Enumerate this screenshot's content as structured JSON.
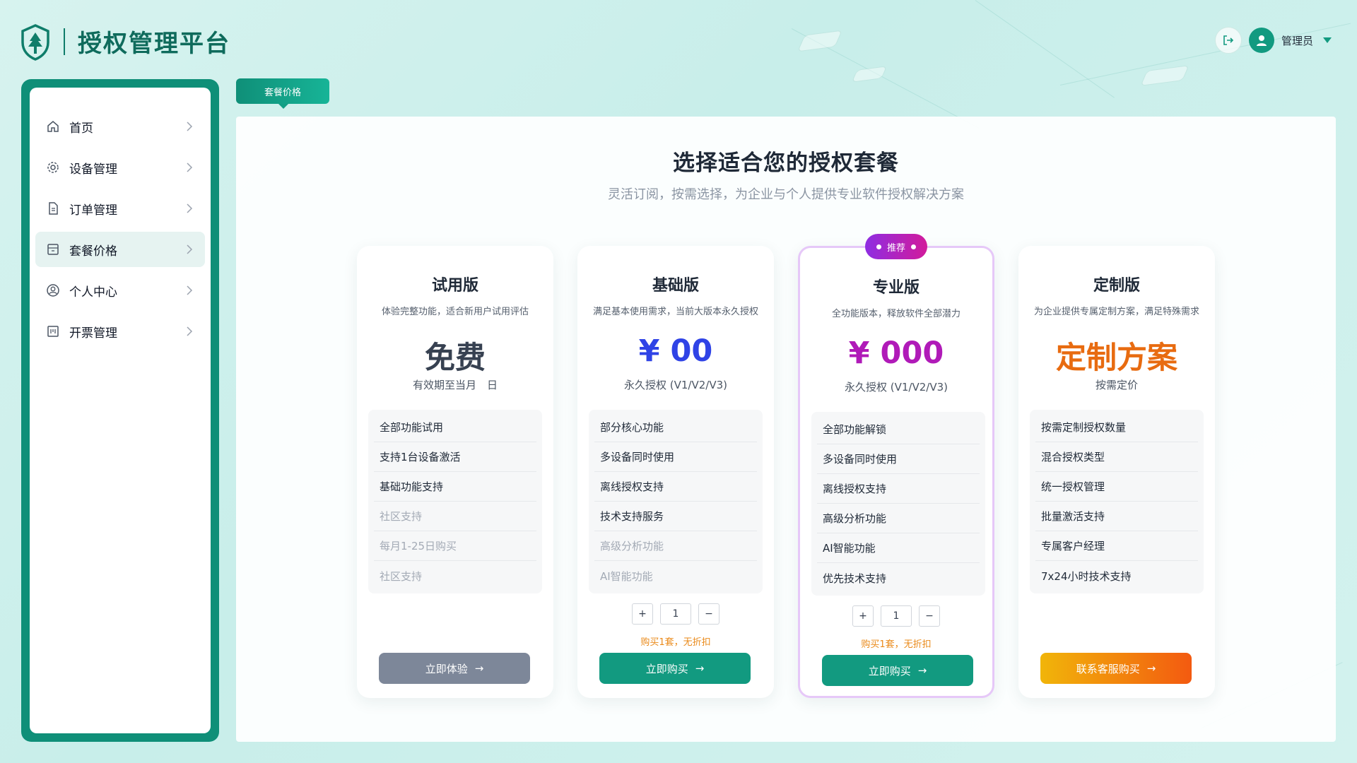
{
  "app": {
    "title": "授权管理平台"
  },
  "user": {
    "name": "管理员"
  },
  "sidebar": {
    "items": [
      {
        "label": "首页",
        "icon": "home-icon"
      },
      {
        "label": "设备管理",
        "icon": "gear-icon"
      },
      {
        "label": "订单管理",
        "icon": "document-icon"
      },
      {
        "label": "套餐价格",
        "icon": "package-icon",
        "active": true
      },
      {
        "label": "个人中心",
        "icon": "user-circle-icon"
      },
      {
        "label": "开票管理",
        "icon": "invoice-icon"
      }
    ]
  },
  "tab": {
    "label": "套餐价格"
  },
  "main": {
    "title": "选择适合您的授权套餐",
    "subtitle": "灵活订阅，按需选择，为企业与个人提供专业软件授权解决方案"
  },
  "plans": [
    {
      "name": "试用版",
      "desc": "体验完整功能，适合新用户试用评估",
      "price": "免费",
      "note": "有效期至当月　日",
      "features": [
        "全部功能试用",
        "支持1台设备激活",
        "基础功能支持",
        "社区支持",
        "每月1-25日购买",
        "社区支持"
      ],
      "cta": "立即体验"
    },
    {
      "name": "基础版",
      "desc": "满足基本使用需求，当前大版本永久授权",
      "price": "¥ 00",
      "note": "永久授权 (V1/V2/V3)",
      "features": [
        "部分核心功能",
        "多设备同时使用",
        "离线授权支持",
        "技术支持服务",
        "高级分析功能",
        "AI智能功能"
      ],
      "qty": "1",
      "qty_note": "购买1套，无折扣",
      "cta": "立即购买"
    },
    {
      "name": "专业版",
      "badge": "推荐",
      "desc": "全功能版本，释放软件全部潜力",
      "price": "¥ 000",
      "note": "永久授权 (V1/V2/V3)",
      "features": [
        "全部功能解锁",
        "多设备同时使用",
        "离线授权支持",
        "高级分析功能",
        "AI智能功能",
        "优先技术支持"
      ],
      "qty": "1",
      "qty_note": "购买1套，无折扣",
      "cta": "立即购买"
    },
    {
      "name": "定制版",
      "desc": "为企业提供专属定制方案，满足特殊需求",
      "price": "定制方案",
      "note": "按需定价",
      "features": [
        "按需定制授权数量",
        "混合授权类型",
        "统一授权管理",
        "批量激活支持",
        "专属客户经理",
        "7x24小时技术支持"
      ],
      "cta": "联系客服购买"
    }
  ],
  "qty_controls": {
    "plus": "+",
    "minus": "−"
  },
  "colors": {
    "brand": "#129a80",
    "brand_dark": "#0f6b5c",
    "price_basic": "#2f43e6",
    "price_pro": "#b01ab8",
    "price_custom": "#e86b10",
    "badge": "#b41fc0"
  }
}
